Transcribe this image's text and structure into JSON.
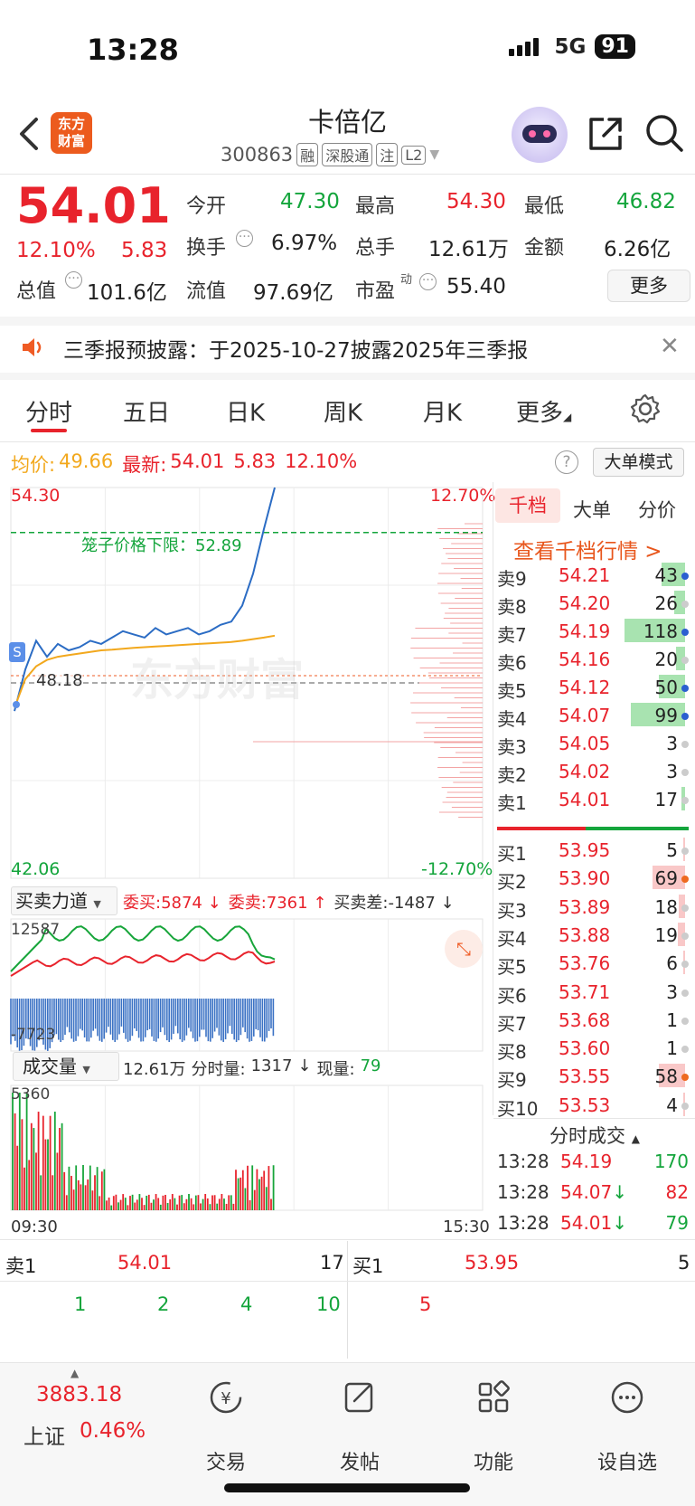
{
  "status": {
    "time": "13:28",
    "network": "5G",
    "battery": "91"
  },
  "header": {
    "logo_text_top": "东方",
    "logo_text_bottom": "财富",
    "title": "卡倍亿",
    "code": "300863",
    "tags": [
      "融",
      "深股通",
      "注",
      "L2"
    ]
  },
  "quote": {
    "price": "54.01",
    "change_pct": "12.10%",
    "change": "5.83",
    "open_label": "今开",
    "open": "47.30",
    "high_label": "最高",
    "high": "54.30",
    "low_label": "最低",
    "low": "46.82",
    "turnover_label": "换手",
    "turnover": "6.97%",
    "volume_label": "总手",
    "volume": "12.61万",
    "amount_label": "金额",
    "amount": "6.26亿",
    "mcap_label": "总值",
    "mcap": "101.6亿",
    "float_label": "流值",
    "float_mcap": "97.69亿",
    "pe_label": "市盈",
    "pe_sup": "动",
    "pe": "55.40",
    "more_label": "更多"
  },
  "notice": {
    "text": "三季报预披露：于2025-10-27披露2025年三季报"
  },
  "tabs": [
    "分时",
    "五日",
    "日K",
    "周K",
    "月K",
    "更多"
  ],
  "info_line": {
    "avg_label": "均价:",
    "avg": "49.66",
    "latest_label": "最新:",
    "latest": "54.01",
    "chg": "5.83",
    "pct": "12.10%",
    "mode_label": "大单模式"
  },
  "chart": {
    "y_top": "54.30",
    "y_bottom": "42.06",
    "pct_top": "12.70%",
    "pct_bottom": "-12.70%",
    "prev_close": "48.18",
    "cage_label": "笼子价格下限：52.89",
    "watermark": "东方财富",
    "s_marker": "S"
  },
  "chart_data": {
    "type": "line",
    "title": "",
    "xlabel": "",
    "ylabel": "",
    "x_range": [
      "09:30",
      "15:30"
    ],
    "ylim": [
      42.06,
      54.3
    ],
    "prev_close": 48.18,
    "cage_lower_limit": 52.89,
    "series": [
      {
        "name": "价格",
        "color": "#2b6cc4",
        "values": [
          47.3,
          48.6,
          49.5,
          49.0,
          49.4,
          49.2,
          49.3,
          49.5,
          49.4,
          49.6,
          49.8,
          49.7,
          49.6,
          49.9,
          49.7,
          49.8,
          49.9,
          49.7,
          49.8,
          50.0,
          50.1,
          50.6,
          51.6,
          53.0,
          54.3
        ]
      },
      {
        "name": "均价",
        "color": "#f2a81d",
        "values": [
          47.4,
          48.3,
          48.7,
          48.9,
          49.0,
          49.05,
          49.1,
          49.15,
          49.2,
          49.22,
          49.25,
          49.28,
          49.3,
          49.32,
          49.34,
          49.36,
          49.38,
          49.4,
          49.42,
          49.44,
          49.46,
          49.5,
          49.55,
          49.6,
          49.66
        ]
      }
    ]
  },
  "force": {
    "label": "买卖力道",
    "buy_label": "委买:",
    "buy": "5874",
    "sell_label": "委卖:",
    "sell": "7361",
    "diff_label": "买卖差:",
    "diff": "-1487",
    "top": "12587",
    "bottom": "-7723"
  },
  "volume": {
    "label": "成交量",
    "total": "12.61万",
    "minute_label": "分时量:",
    "minute": "1317",
    "now_label": "现量:",
    "now": "79",
    "max": "5360",
    "time_start": "09:30",
    "time_end": "15:30"
  },
  "orderbook": {
    "tabs": [
      "千档",
      "大单",
      "分价"
    ],
    "view_link": "查看千档行情 >",
    "asks": [
      {
        "label": "卖9",
        "price": "54.21",
        "vol": "43",
        "bar": 0.22,
        "dot": "#2b5fd0"
      },
      {
        "label": "卖8",
        "price": "54.20",
        "vol": "26",
        "bar": 0.1,
        "dot": "#ccc"
      },
      {
        "label": "卖7",
        "price": "54.19",
        "vol": "118",
        "bar": 0.56,
        "dot": "#2b5fd0"
      },
      {
        "label": "卖6",
        "price": "54.16",
        "vol": "20",
        "bar": 0.08,
        "dot": "#ccc"
      },
      {
        "label": "卖5",
        "price": "54.12",
        "vol": "50",
        "bar": 0.24,
        "dot": "#2b5fd0"
      },
      {
        "label": "卖4",
        "price": "54.07",
        "vol": "99",
        "bar": 0.5,
        "dot": "#2b5fd0"
      },
      {
        "label": "卖3",
        "price": "54.05",
        "vol": "3",
        "bar": 0.0,
        "dot": "#ccc"
      },
      {
        "label": "卖2",
        "price": "54.02",
        "vol": "3",
        "bar": 0.0,
        "dot": "#ccc"
      },
      {
        "label": "卖1",
        "price": "54.01",
        "vol": "17",
        "bar": 0.03,
        "dot": "#ccc"
      }
    ],
    "bids": [
      {
        "label": "买1",
        "price": "53.95",
        "vol": "5",
        "bar": 0.02,
        "dot": "#ccc"
      },
      {
        "label": "买2",
        "price": "53.90",
        "vol": "69",
        "bar": 0.3,
        "dot": "#ee6a1f"
      },
      {
        "label": "买3",
        "price": "53.89",
        "vol": "18",
        "bar": 0.06,
        "dot": "#ccc"
      },
      {
        "label": "买4",
        "price": "53.88",
        "vol": "19",
        "bar": 0.07,
        "dot": "#ccc"
      },
      {
        "label": "买5",
        "price": "53.76",
        "vol": "6",
        "bar": 0.02,
        "dot": "#ccc"
      },
      {
        "label": "买6",
        "price": "53.71",
        "vol": "3",
        "bar": 0.0,
        "dot": "#ccc"
      },
      {
        "label": "买7",
        "price": "53.68",
        "vol": "1",
        "bar": 0.0,
        "dot": "#ccc"
      },
      {
        "label": "买8",
        "price": "53.60",
        "vol": "1",
        "bar": 0.0,
        "dot": "#ccc"
      },
      {
        "label": "买9",
        "price": "53.55",
        "vol": "58",
        "bar": 0.24,
        "dot": "#ee6a1f"
      },
      {
        "label": "买10",
        "price": "53.53",
        "vol": "4",
        "bar": 0.02,
        "dot": "#ccc"
      }
    ],
    "trades_header": "分时成交",
    "trades": [
      {
        "time": "13:28",
        "price": "54.19",
        "arrow": "",
        "vol": "170",
        "vol_color": "#14a53c"
      },
      {
        "time": "13:28",
        "price": "54.07",
        "arrow": "↓",
        "vol": "82",
        "vol_color": "#e8232c"
      },
      {
        "time": "13:28",
        "price": "54.01",
        "arrow": "↓",
        "vol": "79",
        "vol_color": "#14a53c"
      }
    ]
  },
  "levelbar": {
    "ask_label": "卖1",
    "ask_price": "54.01",
    "ask_vol": "17",
    "bid_label": "买1",
    "bid_price": "53.95",
    "bid_vol": "5",
    "ask_queue": [
      "1",
      "2",
      "4",
      "10"
    ],
    "bid_queue": [
      "5"
    ]
  },
  "bottom_nav": {
    "index_value": "3883.18",
    "index_name": "上证",
    "index_pct": "0.46%",
    "items": [
      "交易",
      "发帖",
      "功能",
      "设自选"
    ]
  }
}
